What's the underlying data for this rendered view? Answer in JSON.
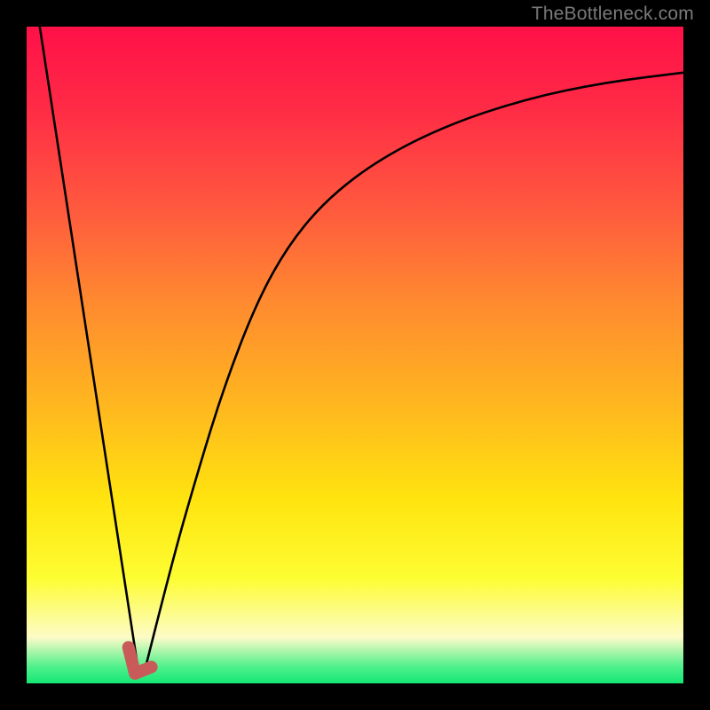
{
  "watermark": {
    "text": "TheBottleneck.com"
  },
  "chart_data": {
    "type": "line",
    "title": "",
    "xlabel": "",
    "ylabel": "",
    "xlim": [
      0,
      100
    ],
    "ylim": [
      0,
      100
    ],
    "grid": false,
    "legend": false,
    "series": [
      {
        "name": "left-descent",
        "description": "steep straight line descending from top-left to minimum",
        "x": [
          2,
          17
        ],
        "y": [
          100,
          2
        ]
      },
      {
        "name": "right-curve",
        "description": "rising curve from the minimum toward the upper right, concave down",
        "x": [
          18,
          22,
          26,
          30,
          35,
          40,
          46,
          54,
          64,
          76,
          88,
          100
        ],
        "y": [
          2,
          18,
          32,
          45,
          58,
          67,
          74,
          80,
          85,
          89,
          91.5,
          93
        ]
      }
    ],
    "highlight": {
      "name": "bottleneck-marker",
      "color": "#c95a5a",
      "points": [
        {
          "x": 15.5,
          "y": 5.5
        },
        {
          "x": 16.5,
          "y": 1.5
        },
        {
          "x": 19.0,
          "y": 2.5
        }
      ]
    },
    "background": {
      "type": "vertical-gradient",
      "stops": [
        {
          "pos": 0.0,
          "color": "#ff1048"
        },
        {
          "pos": 0.28,
          "color": "#ff5a3e"
        },
        {
          "pos": 0.58,
          "color": "#ffb81f"
        },
        {
          "pos": 0.84,
          "color": "#fdfd33"
        },
        {
          "pos": 0.93,
          "color": "#fdfbc7"
        },
        {
          "pos": 1.0,
          "color": "#15e774"
        }
      ]
    }
  }
}
